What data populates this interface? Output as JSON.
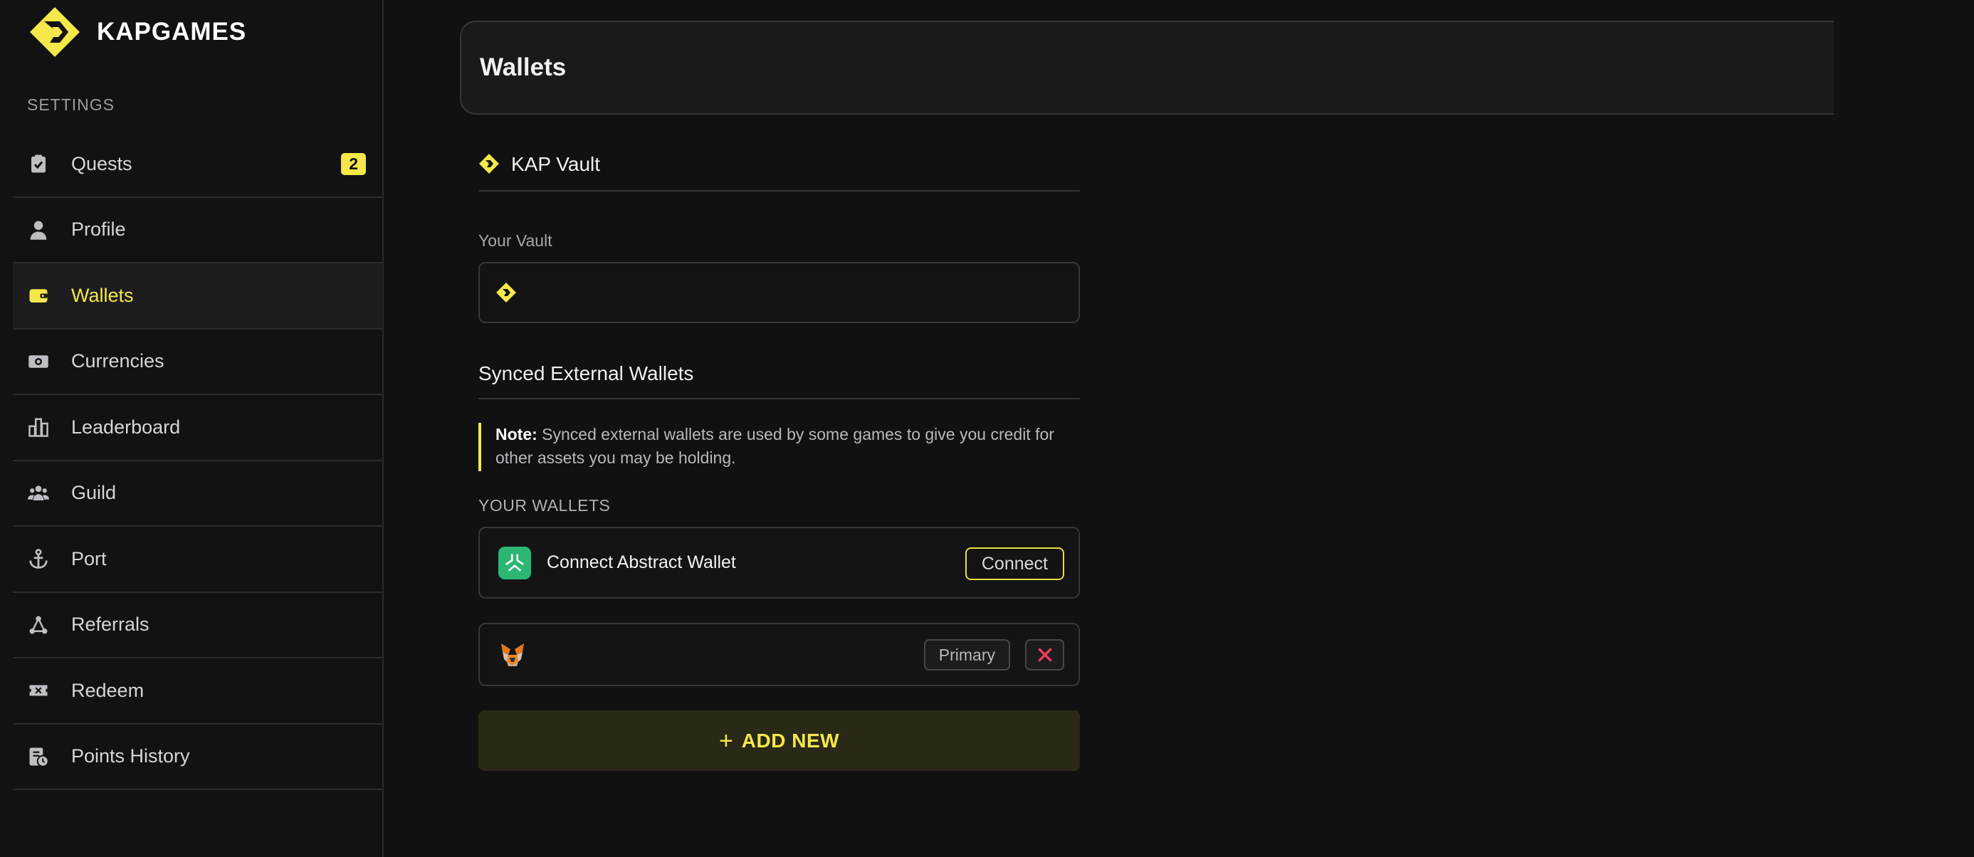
{
  "brand": {
    "name": "KAPGAMES",
    "accent": "#f4e84a"
  },
  "sidebar": {
    "section_label": "SETTINGS",
    "items": [
      {
        "label": "Quests",
        "icon": "clipboard-check-icon",
        "badge": "2"
      },
      {
        "label": "Profile",
        "icon": "user-icon"
      },
      {
        "label": "Wallets",
        "icon": "wallet-icon",
        "active": true
      },
      {
        "label": "Currencies",
        "icon": "cash-icon"
      },
      {
        "label": "Leaderboard",
        "icon": "bar-chart-icon"
      },
      {
        "label": "Guild",
        "icon": "group-icon"
      },
      {
        "label": "Port",
        "icon": "anchor-icon"
      },
      {
        "label": "Referrals",
        "icon": "network-icon"
      },
      {
        "label": "Redeem",
        "icon": "ticket-icon"
      },
      {
        "label": "Points History",
        "icon": "history-icon"
      }
    ]
  },
  "main": {
    "title": "Wallets",
    "vault": {
      "heading": "KAP Vault",
      "sub_label": "Your Vault"
    },
    "synced": {
      "heading": "Synced External Wallets",
      "note_bold": "Note:",
      "note_text": " Synced external wallets are used by some games to give you credit for other assets you may be holding.",
      "your_wallets_label": "YOUR WALLETS",
      "abstract": {
        "name": "Connect Abstract Wallet",
        "button": "Connect"
      },
      "metamask": {
        "primary_label": "Primary"
      },
      "add_button": "ADD NEW"
    }
  }
}
